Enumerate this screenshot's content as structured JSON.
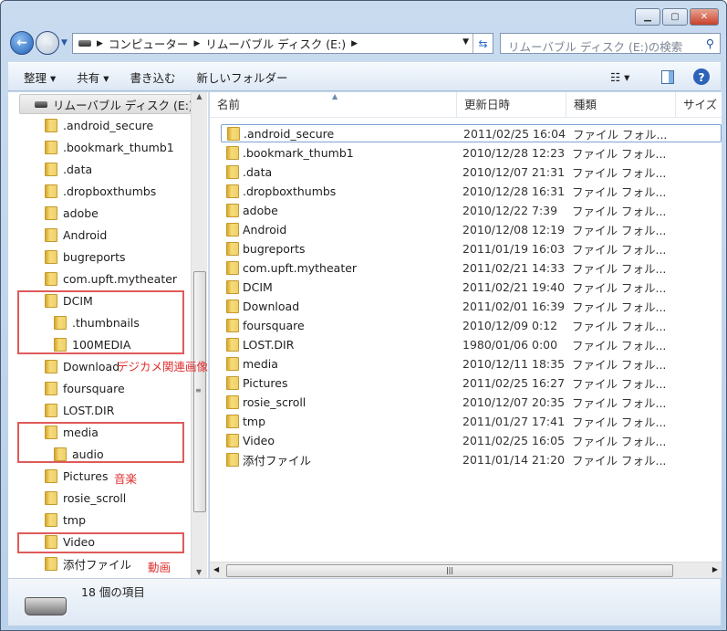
{
  "window": {
    "controls": [
      "minimize",
      "maximize",
      "close"
    ]
  },
  "address": {
    "segments": [
      "コンピューター",
      "リムーバブル ディスク (E:)"
    ]
  },
  "search": {
    "placeholder": "リムーバブル ディスク (E:)の検索"
  },
  "toolbar": {
    "organize": "整理 ▾",
    "share": "共有 ▾",
    "burn": "書き込む",
    "new_folder": "新しいフォルダー"
  },
  "tree": {
    "root": "リムーバブル ディスク (E:)",
    "items": [
      {
        "label": ".android_secure",
        "level": 1
      },
      {
        "label": ".bookmark_thumb1",
        "level": 1
      },
      {
        "label": ".data",
        "level": 1
      },
      {
        "label": ".dropboxthumbs",
        "level": 1
      },
      {
        "label": "adobe",
        "level": 1
      },
      {
        "label": "Android",
        "level": 1
      },
      {
        "label": "bugreports",
        "level": 1
      },
      {
        "label": "com.upft.mytheater",
        "level": 1
      },
      {
        "label": "DCIM",
        "level": 1
      },
      {
        "label": ".thumbnails",
        "level": 2
      },
      {
        "label": "100MEDIA",
        "level": 2
      },
      {
        "label": "Download",
        "level": 1
      },
      {
        "label": "foursquare",
        "level": 1
      },
      {
        "label": "LOST.DIR",
        "level": 1
      },
      {
        "label": "media",
        "level": 1
      },
      {
        "label": "audio",
        "level": 2
      },
      {
        "label": "Pictures",
        "level": 1
      },
      {
        "label": "rosie_scroll",
        "level": 1
      },
      {
        "label": "tmp",
        "level": 1
      },
      {
        "label": "Video",
        "level": 1
      },
      {
        "label": "添付ファイル",
        "level": 1
      }
    ]
  },
  "annotations": {
    "camera": "デジカメ関連画像",
    "music": "音楽",
    "video": "動画",
    "color": "#e03030"
  },
  "columns": {
    "name": "名前",
    "date": "更新日時",
    "type": "種類",
    "size": "サイズ"
  },
  "files": [
    {
      "name": ".android_secure",
      "date": "2011/02/25 16:04",
      "type": "ファイル フォル..."
    },
    {
      "name": ".bookmark_thumb1",
      "date": "2010/12/28 12:23",
      "type": "ファイル フォル..."
    },
    {
      "name": ".data",
      "date": "2010/12/07 21:31",
      "type": "ファイル フォル..."
    },
    {
      "name": ".dropboxthumbs",
      "date": "2010/12/28 16:31",
      "type": "ファイル フォル..."
    },
    {
      "name": "adobe",
      "date": "2010/12/22 7:39",
      "type": "ファイル フォル..."
    },
    {
      "name": "Android",
      "date": "2010/12/08 12:19",
      "type": "ファイル フォル..."
    },
    {
      "name": "bugreports",
      "date": "2011/01/19 16:03",
      "type": "ファイル フォル..."
    },
    {
      "name": "com.upft.mytheater",
      "date": "2011/02/21 14:33",
      "type": "ファイル フォル..."
    },
    {
      "name": "DCIM",
      "date": "2011/02/21 19:40",
      "type": "ファイル フォル..."
    },
    {
      "name": "Download",
      "date": "2011/02/01 16:39",
      "type": "ファイル フォル..."
    },
    {
      "name": "foursquare",
      "date": "2010/12/09 0:12",
      "type": "ファイル フォル..."
    },
    {
      "name": "LOST.DIR",
      "date": "1980/01/06 0:00",
      "type": "ファイル フォル..."
    },
    {
      "name": "media",
      "date": "2010/12/11 18:35",
      "type": "ファイル フォル..."
    },
    {
      "name": "Pictures",
      "date": "2011/02/25 16:27",
      "type": "ファイル フォル..."
    },
    {
      "name": "rosie_scroll",
      "date": "2010/12/07 20:35",
      "type": "ファイル フォル..."
    },
    {
      "name": "tmp",
      "date": "2011/01/27 17:41",
      "type": "ファイル フォル..."
    },
    {
      "name": "Video",
      "date": "2011/02/25 16:05",
      "type": "ファイル フォル..."
    },
    {
      "name": "添付ファイル",
      "date": "2011/01/14 21:20",
      "type": "ファイル フォル..."
    }
  ],
  "status": {
    "count": "18 個の項目"
  }
}
